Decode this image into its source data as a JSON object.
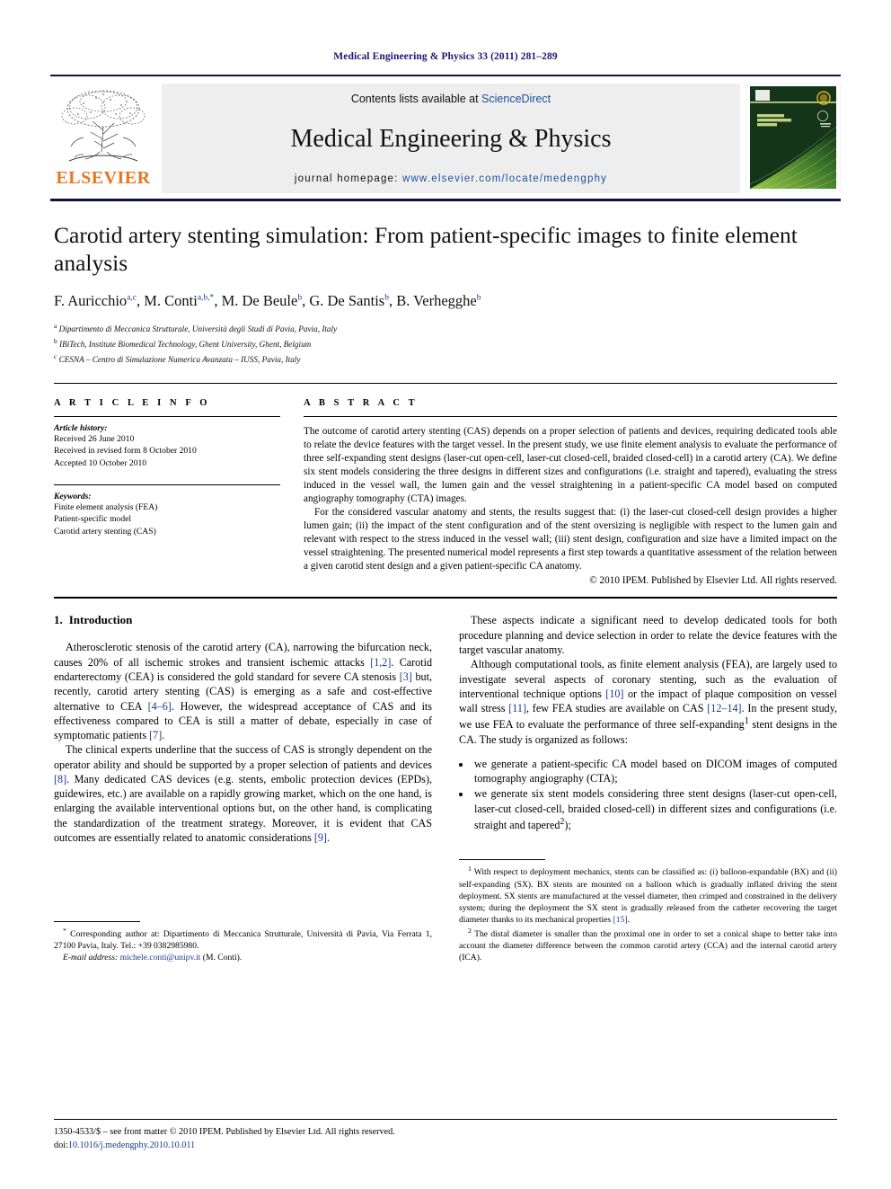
{
  "running_head": "Medical Engineering & Physics 33 (2011) 281–289",
  "masthead": {
    "publisher_name": "ELSEVIER",
    "contents_prefix": "Contents lists available at",
    "contents_link": "ScienceDirect",
    "journal_title": "Medical Engineering & Physics",
    "homepage_prefix": "journal homepage:",
    "homepage_url": "www.elsevier.com/locate/medengphy",
    "cover_title_lines": [
      "MEDICAL",
      "ENGINEERING",
      "& PHYSICS"
    ]
  },
  "article": {
    "title": "Carotid artery stenting simulation: From patient-specific images to finite element analysis",
    "authors_html": "F. Auricchio<sup>a,c</sup>, M. Conti<sup>a,b,*</sup>, M. De Beule<sup>b</sup>, G. De Santis<sup>b</sup>, B. Verhegghe<sup>b</sup>",
    "affiliations": [
      {
        "marker": "a",
        "text": "Dipartimento di Meccanica Strutturale, Università degli Studi di Pavia, Pavia, Italy"
      },
      {
        "marker": "b",
        "text": "IBiTech, Institute Biomedical Technology, Ghent University, Ghent, Belgium"
      },
      {
        "marker": "c",
        "text": "CESNA – Centro di Simulazione Numerica Avanzata – IUSS, Pavia, Italy"
      }
    ]
  },
  "article_info": {
    "heading": "A R T I C L E    I N F O",
    "history_label": "Article history:",
    "history": [
      "Received 26 June 2010",
      "Received in revised form 8 October 2010",
      "Accepted 10 October 2010"
    ],
    "keywords_label": "Keywords:",
    "keywords": [
      "Finite element analysis (FEA)",
      "Patient-specific model",
      "Carotid artery stenting (CAS)"
    ]
  },
  "abstract": {
    "heading": "A B S T R A C T",
    "paragraphs": [
      "The outcome of carotid artery stenting (CAS) depends on a proper selection of patients and devices, requiring dedicated tools able to relate the device features with the target vessel. In the present study, we use finite element analysis to evaluate the performance of three self-expanding stent designs (laser-cut open-cell, laser-cut closed-cell, braided closed-cell) in a carotid artery (CA). We define six stent models considering the three designs in different sizes and configurations (i.e. straight and tapered), evaluating the stress induced in the vessel wall, the lumen gain and the vessel straightening in a patient-specific CA model based on computed angiography tomography (CTA) images.",
      "For the considered vascular anatomy and stents, the results suggest that: (i) the laser-cut closed-cell design provides a higher lumen gain; (ii) the impact of the stent configuration and of the stent oversizing is negligible with respect to the lumen gain and relevant with respect to the stress induced in the vessel wall; (iii) stent design, configuration and size have a limited impact on the vessel straightening. The presented numerical model represents a first step towards a quantitative assessment of the relation between a given carotid stent design and a given patient-specific CA anatomy."
    ],
    "copyright": "© 2010 IPEM. Published by Elsevier Ltd. All rights reserved."
  },
  "sections": {
    "intro_number": "1.",
    "intro_title": "Introduction"
  },
  "left_column": {
    "paragraphs": [
      "Atherosclerotic stenosis of the carotid artery (CA), narrowing the bifurcation neck, causes 20% of all ischemic strokes and transient ischemic attacks [1,2]. Carotid endarterectomy (CEA) is considered the gold standard for severe CA stenosis [3] but, recently, carotid artery stenting (CAS) is emerging as a safe and cost-effective alternative to CEA [4–6]. However, the widespread acceptance of CAS and its effectiveness compared to CEA is still a matter of debate, especially in case of symptomatic patients [7].",
      "The clinical experts underline that the success of CAS is strongly dependent on the operator ability and should be supported by a proper selection of patients and devices [8]. Many dedicated CAS devices (e.g. stents, embolic protection devices (EPDs), guidewires, etc.) are available on a rapidly growing market, which on the one hand, is enlarging the available interventional options but, on the other hand, is complicating the standardization of the treatment strategy. Moreover, it is evident that CAS outcomes are essentially related to anatomic considerations [9]."
    ],
    "corresponding_note": "Corresponding author at: Dipartimento di Meccanica Strutturale, Università di Pavia, Via Ferrata 1, 27100 Pavia, Italy. Tel.: +39 0382985980.",
    "email_label": "E-mail address:",
    "email": "michele.conti@unipv.it",
    "email_suffix": "(M. Conti)."
  },
  "right_column": {
    "paragraphs": [
      "These aspects indicate a significant need to develop dedicated tools for both procedure planning and device selection in order to relate the device features with the target vascular anatomy.",
      "Although computational tools, as finite element analysis (FEA), are largely used to investigate several aspects of coronary stenting, such as the evaluation of interventional technique options [10] or the impact of plaque composition on vessel wall stress [11], few FEA studies are available on CAS [12–14]. In the present study, we use FEA to evaluate the performance of three self-expanding¹ stent designs in the CA. The study is organized as follows:"
    ],
    "bullets": [
      "we generate a patient-specific CA model based on DICOM images of computed tomography angiography (CTA);",
      "we generate six stent models considering three stent designs (laser-cut open-cell, laser-cut closed-cell, braided closed-cell) in different sizes and configurations (i.e. straight and tapered²);"
    ],
    "footnotes": [
      "With respect to deployment mechanics, stents can be classified as: (i) balloon-expandable (BX) and (ii) self-expanding (SX). BX stents are mounted on a balloon which is gradually inflated driving the stent deployment. SX stents are manufactured at the vessel diameter, then crimped and constrained in the delivery system; during the deployment the SX stent is gradually released from the catheter recovering the target diameter thanks to its mechanical properties [15].",
      "The distal diameter is smaller than the proximal one in order to set a conical shape to better take into account the diameter difference between the common carotid artery (CCA) and the internal carotid artery (ICA)."
    ]
  },
  "footer": {
    "issn_line": "1350-4533/$ – see front matter © 2010 IPEM. Published by Elsevier Ltd. All rights reserved.",
    "doi_prefix": "doi:",
    "doi": "10.1016/j.medengphy.2010.10.011"
  },
  "colors": {
    "link_blue": "#1a3a8f",
    "sciencedirect_blue": "#1a4f9c",
    "elsevier_orange": "#E87722",
    "cover_green": "#1d4523",
    "rule_navy": "#12123f"
  }
}
